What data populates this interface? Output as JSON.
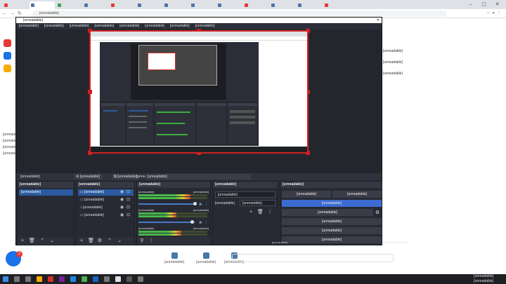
{
  "colors": {
    "obs_bg": "#2b2e38",
    "accent_blue": "#3c6bd1",
    "record_red": "#d02020",
    "meter_green": "#49b84a"
  },
  "browser": {
    "tabs": [
      {
        "label": "",
        "favicon_color": "#e53935"
      },
      {
        "label": "",
        "favicon_color": "#4a76a8"
      },
      {
        "label": "",
        "favicon_color": "#34a853"
      },
      {
        "label": "",
        "favicon_color": "#4a76a8"
      },
      {
        "label": "",
        "favicon_color": "#e53935"
      },
      {
        "label": "",
        "favicon_color": "#4a76a8"
      },
      {
        "label": "",
        "favicon_color": "#4a76a8"
      },
      {
        "label": "",
        "favicon_color": "#4a76a8"
      },
      {
        "label": "",
        "favicon_color": "#4a76a8"
      },
      {
        "label": "",
        "favicon_color": "#e53935"
      },
      {
        "label": "",
        "favicon_color": "#4a76a8"
      },
      {
        "label": "",
        "favicon_color": "#4a76a8"
      },
      {
        "label": "",
        "favicon_color": "#e53935"
      }
    ],
    "url": "[unreadable]",
    "window_controls": [
      "–",
      "▢",
      "✕"
    ]
  },
  "obs": {
    "title": "[unreadable]",
    "menu": [
      "[unreadable]",
      "[unreadable]",
      "[unreadable]",
      "[unreadable]",
      "[unreadable]",
      "[unreadable]",
      "[unreadable]",
      "[unreadable]",
      "[unreadable]"
    ],
    "toolbar": {
      "selected_source": "[unreadable]",
      "properties": "[unreadable]",
      "filters": "[unreadable]",
      "device_label": "[unreadable]",
      "device_value": "[unreadable]"
    },
    "docks": {
      "scenes": {
        "title": "[unreadable]",
        "items": [
          {
            "label": "[unreadable]",
            "selected": true
          }
        ]
      },
      "sources": {
        "title": "[unreadable]",
        "items": [
          {
            "label": "[unreadable]",
            "selected": true
          },
          {
            "label": "[unreadable]",
            "selected": false
          },
          {
            "label": "[unreadable]",
            "selected": false
          },
          {
            "label": "[unreadable]",
            "selected": false
          }
        ]
      },
      "mixer": {
        "title": "[unreadable]",
        "channels": [
          {
            "name": "[unreadable]",
            "db": "[unreadable]",
            "level": 0.75
          },
          {
            "name": "[unreadable]",
            "db": "[unreadable]",
            "level": 0.55
          },
          {
            "name": "[unreadable]",
            "db": "[unreadable]",
            "level": 0.62
          }
        ]
      },
      "transitions": {
        "title": "[unreadable]",
        "type": "[unreadable]",
        "duration_label": "[unreadable]",
        "duration_value": "[unreadable]"
      },
      "controls": {
        "title": "[unreadable]",
        "buttons": [
          {
            "label": "[unreadable]",
            "label2": "[unreadable]"
          },
          {
            "label": "[unreadable]",
            "highlight": true
          },
          {
            "label": "[unreadable]"
          },
          {
            "label": "[unreadable]"
          },
          {
            "label": "[unreadable]"
          },
          {
            "label": "[unreadable]"
          }
        ]
      }
    },
    "status": "[unreadable]"
  },
  "page": {
    "left_text": [
      "[unreadable]",
      "[unreadable]",
      "[unreadable]",
      "[unreadable]"
    ],
    "chat_badge": "2",
    "right_text": [
      "[unreadable]",
      "[unreadable]",
      "[unreadable]"
    ],
    "bottom_nav": [
      "[unreadable]",
      "[unreadable]",
      "[unreadable]"
    ]
  },
  "taskbar": {
    "time": "[unreadable]",
    "date": "[unreadable]"
  }
}
